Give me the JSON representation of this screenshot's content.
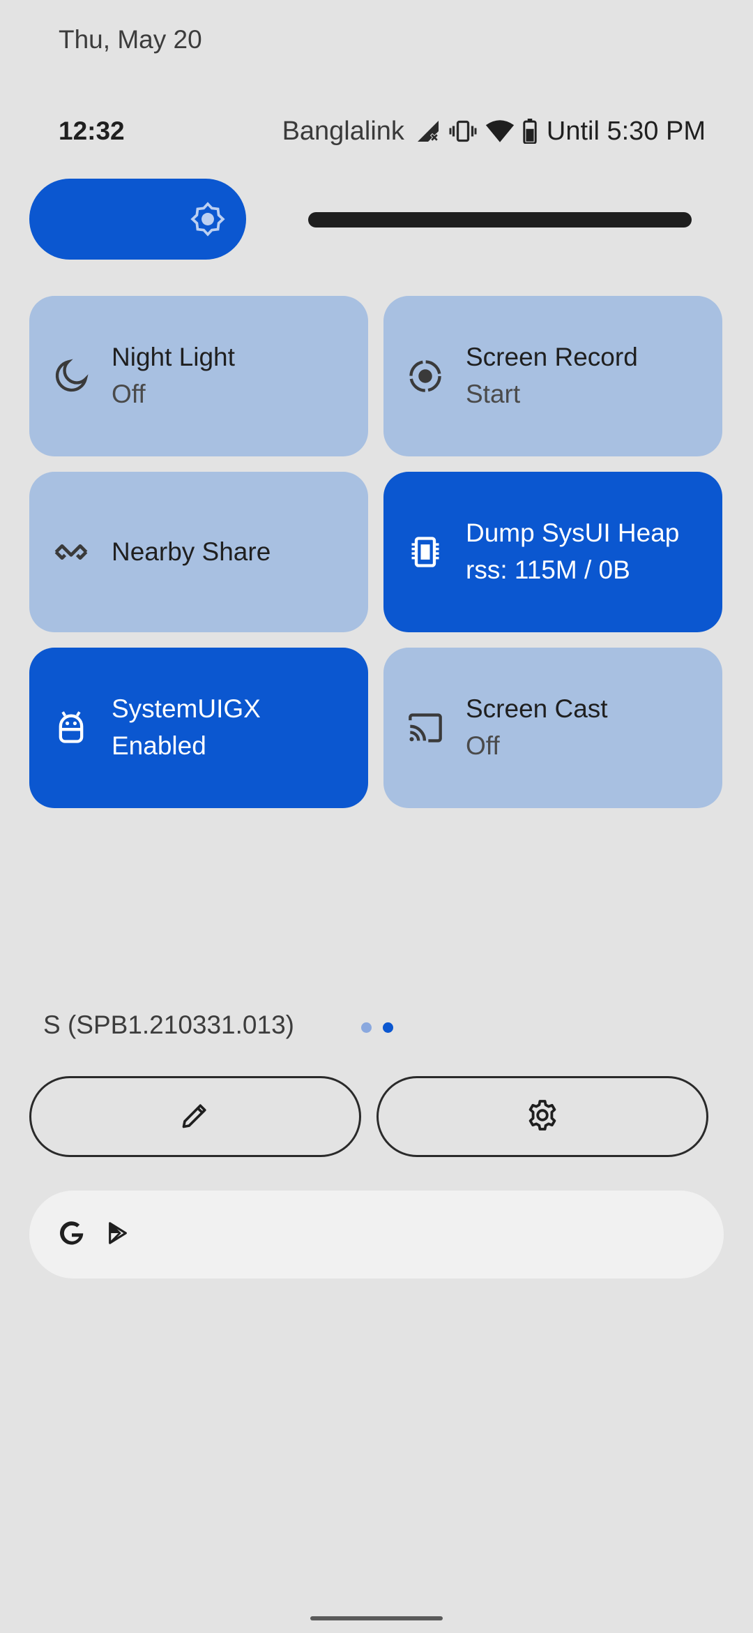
{
  "header": {
    "date": "Thu, May 20",
    "time": "12:32",
    "carrier": "Banglalink",
    "battery_text": "Until 5:30 PM"
  },
  "brightness": {
    "level": 0.3,
    "icon": "brightness-icon"
  },
  "tiles": [
    {
      "title": "Night Light",
      "subtitle": "Off",
      "icon": "moon-icon",
      "active": false
    },
    {
      "title": "Screen Record",
      "subtitle": "Start",
      "icon": "screen-record-icon",
      "active": false
    },
    {
      "title": "Nearby Share",
      "subtitle": "",
      "icon": "nearby-share-icon",
      "active": false
    },
    {
      "title": "Dump SysUI Heap",
      "subtitle": "rss: 115M / 0B",
      "icon": "memory-chip-icon",
      "active": true
    },
    {
      "title": "SystemUIGX",
      "subtitle": "Enabled",
      "icon": "android-icon",
      "active": true
    },
    {
      "title": "Screen Cast",
      "subtitle": "Off",
      "icon": "cast-icon",
      "active": false
    }
  ],
  "footer": {
    "build": "S (SPB1.210331.013)",
    "page_count": 2,
    "current_page": 2,
    "edit_icon": "pencil-icon",
    "settings_icon": "gear-icon"
  },
  "search": {
    "icons": [
      "google-g-icon",
      "play-store-icon"
    ]
  },
  "colors": {
    "background": "#e3e3e3",
    "accent": "#0b57d0",
    "tile_inactive": "#a8c0e1",
    "search_bg": "#f1f1f1"
  }
}
